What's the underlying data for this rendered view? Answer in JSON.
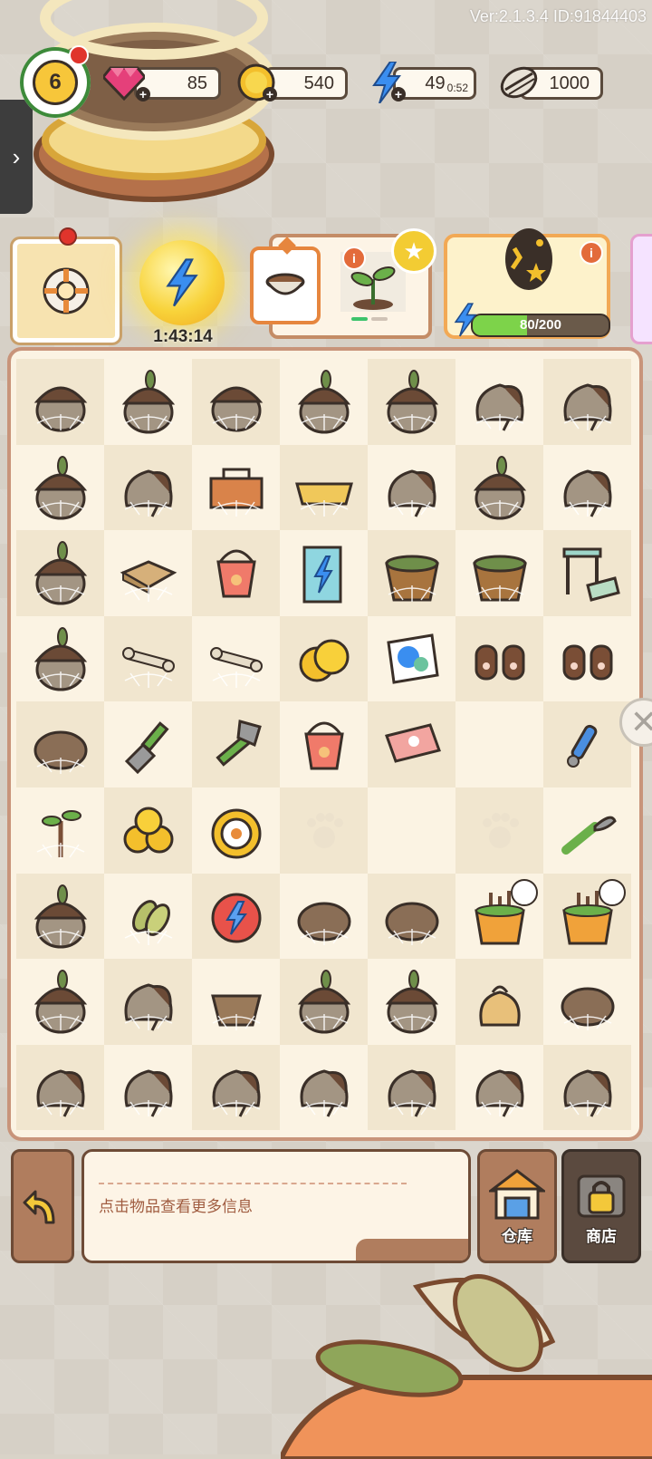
{
  "version_text": "Ver:2.1.3.4 ID:91844403",
  "player": {
    "level": "6"
  },
  "resources": {
    "gems": "85",
    "coins": "540",
    "energy": "49",
    "energy_timer": "0:52",
    "seeds": "1000"
  },
  "energy_orb": {
    "timer": "1:43:14"
  },
  "egg": {
    "progress_text": "80/200",
    "progress_fraction": 0.4
  },
  "order": {
    "progress_steps_done": 1,
    "progress_steps_total": 2
  },
  "board": {
    "columns": 7,
    "rows": [
      [
        "acorn-cobweb",
        "acorn-leaf-cobweb",
        "acorn-cobweb",
        "acorn-leaf-cobweb",
        "acorn-leaf-cobweb",
        "sack-cobweb",
        "sack-cobweb"
      ],
      [
        "acorn-leaf-cobweb",
        "sack-cobweb",
        "toolbox-cobweb",
        "tray-cobweb",
        "sack-cobweb",
        "acorn-leaf-cobweb",
        "sack-cobweb"
      ],
      [
        "acorn-leaf-cobweb",
        "crate-cobweb",
        "pet-bucket",
        "lightning-cabinet",
        "wooden-tub-cobweb",
        "wooden-tub-cobweb",
        "side-table"
      ],
      [
        "acorn-leaf-cobweb",
        "bone-cobweb",
        "bone-cobweb",
        "coins",
        "pet-blanket",
        "paw-gloves",
        "paw-gloves"
      ],
      [
        "rock-cobweb",
        "trowel",
        "hatchet",
        "pet-bucket",
        "pet-towel",
        "empty",
        "blue-wrench"
      ],
      [
        "sapling-cobweb",
        "coin-pile",
        "golden-compass",
        "paw-print",
        "empty",
        "paw-print",
        "pruning-knife"
      ],
      [
        "acorn-leaf-cobweb",
        "seed-cobweb",
        "energy-token",
        "rock-cobweb",
        "rock-cobweb",
        "tool-bucket-timer",
        "tool-bucket-timer"
      ],
      [
        "acorn-leaf-cobweb",
        "sack-cobweb",
        "basket-cobweb",
        "acorn-leaf-cobweb",
        "acorn-leaf-cobweb",
        "seed-bag",
        "rock-cobweb"
      ],
      [
        "sack-cobweb",
        "sack-cobweb",
        "sack-cobweb",
        "sack-cobweb",
        "sack-cobweb",
        "sack-cobweb",
        "sack-cobweb"
      ]
    ]
  },
  "bottom": {
    "hint": "点击物品查看更多信息",
    "warehouse_label": "仓库",
    "shop_label": "商店"
  },
  "colors": {
    "accent": "#f3cc33",
    "panel_border": "#c8947a",
    "energy_bar": "#7dd34a"
  }
}
